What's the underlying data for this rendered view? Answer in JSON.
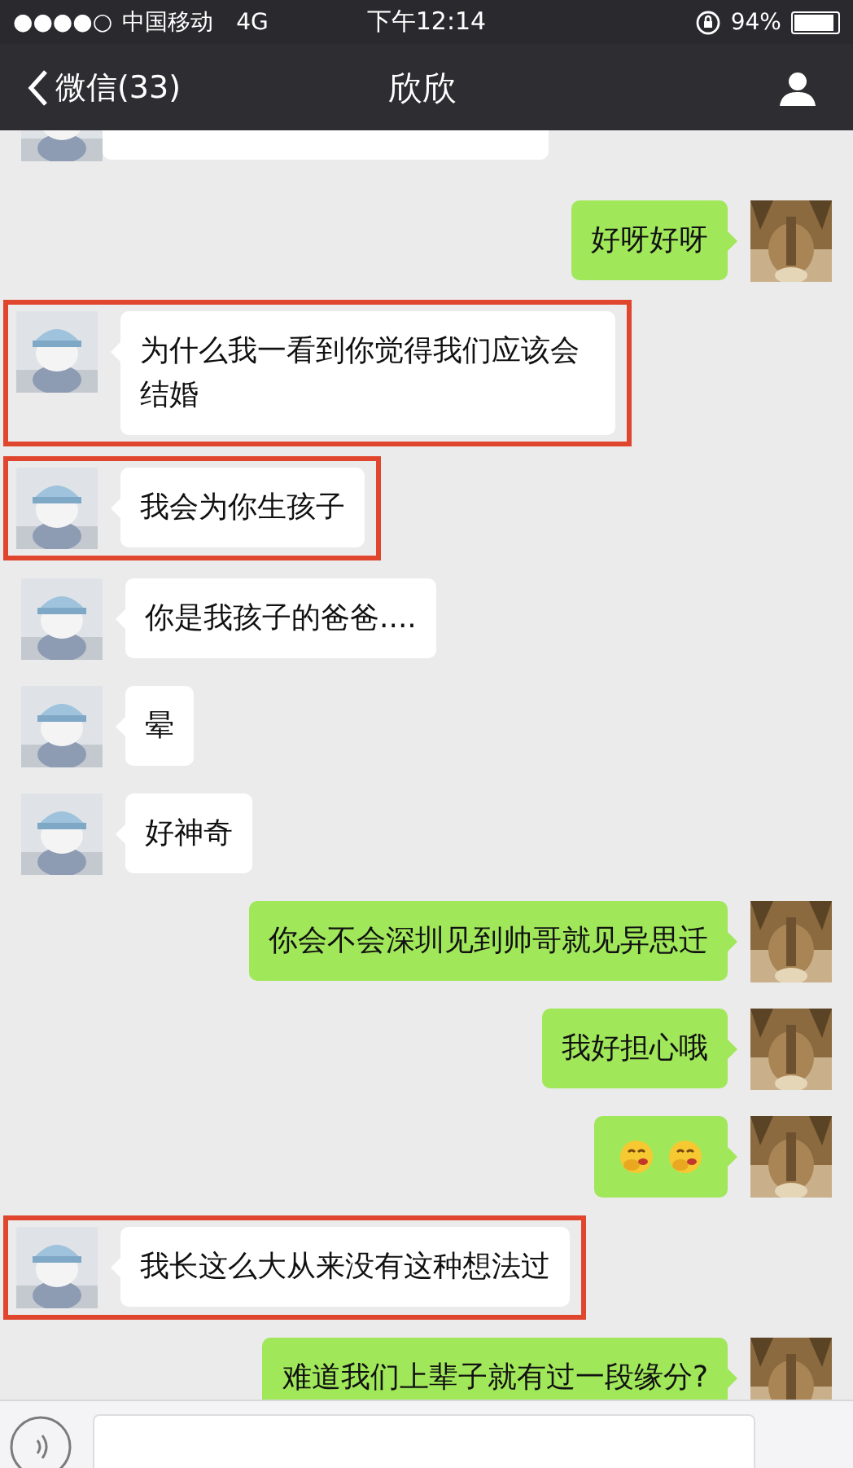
{
  "status_bar": {
    "signal_dots": "●●●●○",
    "carrier": "中国移动",
    "network": "4G",
    "time": "下午12:14",
    "battery": "94%"
  },
  "nav": {
    "back": "微信(33)",
    "title": "欣欣"
  },
  "messages": [
    {
      "kind": "received_cut",
      "highlighted": false
    },
    {
      "kind": "sent_text",
      "text": "好呀好呀",
      "highlighted": false
    },
    {
      "kind": "received_text",
      "text": "为什么我一看到你觉得我们应该会结婚",
      "highlighted": true
    },
    {
      "kind": "received_text",
      "text": "我会为你生孩子",
      "highlighted": true
    },
    {
      "kind": "received_text",
      "text": "你是我孩子的爸爸....",
      "highlighted": false
    },
    {
      "kind": "received_text",
      "text": "晕",
      "highlighted": false
    },
    {
      "kind": "received_text",
      "text": "好神奇",
      "highlighted": false
    },
    {
      "kind": "sent_text",
      "text": "你会不会深圳见到帅哥就见异思迁",
      "highlighted": false
    },
    {
      "kind": "sent_text",
      "text": "我好担心哦",
      "highlighted": false
    },
    {
      "kind": "sent_emoji",
      "highlighted": false
    },
    {
      "kind": "received_text",
      "text": "我长这么大从来没有这种想法过",
      "highlighted": true
    },
    {
      "kind": "sent_text",
      "text": "难道我们上辈子就有过一段缘分?",
      "highlighted": false
    }
  ]
}
